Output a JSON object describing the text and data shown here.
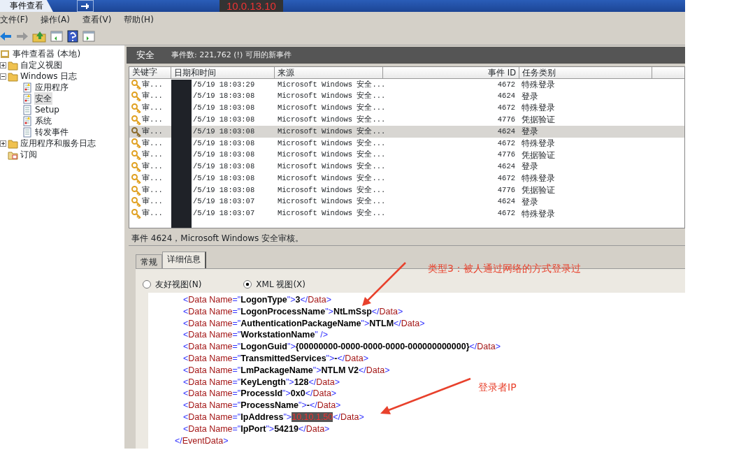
{
  "window": {
    "tab_title": "事件查看",
    "host": "10.0.13.10"
  },
  "menu": [
    "文件(F)",
    "操作(A)",
    "查看(V)",
    "帮助(H)"
  ],
  "tree": [
    {
      "label": "事件查看器 (本地)",
      "kind": "root",
      "selected": false,
      "children": [
        {
          "label": "自定义视图",
          "kind": "folder",
          "selected": false,
          "expanded": false
        },
        {
          "label": "Windows 日志",
          "kind": "folder",
          "selected": false,
          "expanded": true,
          "children": [
            {
              "label": "应用程序",
              "kind": "log",
              "selected": false
            },
            {
              "label": "安全",
              "kind": "log",
              "selected": true
            },
            {
              "label": "Setup",
              "kind": "plainlog",
              "selected": false
            },
            {
              "label": "系统",
              "kind": "log",
              "selected": false
            },
            {
              "label": "转发事件",
              "kind": "plainlog",
              "selected": false
            }
          ]
        },
        {
          "label": "应用程序和服务日志",
          "kind": "folder",
          "selected": false,
          "expanded": false
        },
        {
          "label": "订阅",
          "kind": "subscription",
          "selected": false
        }
      ]
    }
  ],
  "log_header": {
    "title": "安全",
    "summary": "事件数: 221,762 (!) 可用的新事件"
  },
  "table": {
    "columns": [
      "关键字",
      "日期和时间",
      "来源",
      "事件 ID",
      "任务类别"
    ],
    "rows": [
      {
        "keyword": "审...",
        "date": "/5/19 18:03:29",
        "source": "Microsoft Windows 安全...",
        "id": "4672",
        "task": "特殊登录",
        "selected": false
      },
      {
        "keyword": "审...",
        "date": "/5/19 18:03:08",
        "source": "Microsoft Windows 安全...",
        "id": "4624",
        "task": "登录",
        "selected": false
      },
      {
        "keyword": "审...",
        "date": "/5/19 18:03:08",
        "source": "Microsoft Windows 安全...",
        "id": "4672",
        "task": "特殊登录",
        "selected": false
      },
      {
        "keyword": "审...",
        "date": "/5/19 18:03:08",
        "source": "Microsoft Windows 安全...",
        "id": "4776",
        "task": "凭据验证",
        "selected": false
      },
      {
        "keyword": "审...",
        "date": "/5/19 18:03:08",
        "source": "Microsoft Windows 安全...",
        "id": "4624",
        "task": "登录",
        "selected": true
      },
      {
        "keyword": "审...",
        "date": "/5/19 18:03:08",
        "source": "Microsoft Windows 安全...",
        "id": "4672",
        "task": "特殊登录",
        "selected": false
      },
      {
        "keyword": "审...",
        "date": "/5/19 18:03:08",
        "source": "Microsoft Windows 安全...",
        "id": "4776",
        "task": "凭据验证",
        "selected": false
      },
      {
        "keyword": "审...",
        "date": "/5/19 18:03:08",
        "source": "Microsoft Windows 安全...",
        "id": "4624",
        "task": "登录",
        "selected": false
      },
      {
        "keyword": "审...",
        "date": "/5/19 18:03:08",
        "source": "Microsoft Windows 安全...",
        "id": "4672",
        "task": "特殊登录",
        "selected": false
      },
      {
        "keyword": "审...",
        "date": "/5/19 18:03:08",
        "source": "Microsoft Windows 安全...",
        "id": "4776",
        "task": "凭据验证",
        "selected": false
      },
      {
        "keyword": "审...",
        "date": "/5/19 18:03:07",
        "source": "Microsoft Windows 安全...",
        "id": "4624",
        "task": "登录",
        "selected": false
      },
      {
        "keyword": "审...",
        "date": "/5/19 18:03:07",
        "source": "Microsoft Windows 安全...",
        "id": "4672",
        "task": "特殊登录",
        "selected": false
      }
    ]
  },
  "detail": {
    "title": "事件 4624，Microsoft Windows 安全审核。",
    "tabs": [
      {
        "label": "常规",
        "selected": false
      },
      {
        "label": "详细信息",
        "selected": true
      }
    ],
    "views": [
      {
        "label": "友好视图(N)",
        "selected": false
      },
      {
        "label": "XML 视图(X)",
        "selected": true
      }
    ],
    "xml": [
      {
        "text": "<Data Name=\"LogonType\">3</Data>",
        "highlighted": false
      },
      {
        "text": "<Data Name=\"LogonProcessName\">NtLmSsp</Data>",
        "highlighted": false
      },
      {
        "text": "<Data Name=\"AuthenticationPackageName\">NTLM</Data>",
        "highlighted": false
      },
      {
        "text": "<Data Name=\"WorkstationName\" />",
        "highlighted": false
      },
      {
        "text": "<Data Name=\"LogonGuid\">{00000000-0000-0000-0000-000000000000}</Data>",
        "highlighted": false
      },
      {
        "text": "<Data Name=\"TransmittedServices\">-</Data>",
        "highlighted": false
      },
      {
        "text": "<Data Name=\"LmPackageName\">NTLM V2</Data>",
        "highlighted": false
      },
      {
        "text": "<Data Name=\"KeyLength\">128</Data>",
        "highlighted": false
      },
      {
        "text": "<Data Name=\"ProcessId\">0x0</Data>",
        "highlighted": false
      },
      {
        "text": "<Data Name=\"ProcessName\">-</Data>",
        "highlighted": false
      },
      {
        "text": "<Data Name=\"IpAddress\">10.10.1.50</Data>",
        "highlighted": true
      },
      {
        "text": "<Data Name=\"IpPort\">54219</Data>",
        "highlighted": false
      },
      {
        "text": "</EventData>",
        "highlighted": false
      }
    ]
  },
  "annotations": [
    {
      "text": "类型3：被人通过网络的方式登录过"
    },
    {
      "text": "登录者IP"
    }
  ]
}
